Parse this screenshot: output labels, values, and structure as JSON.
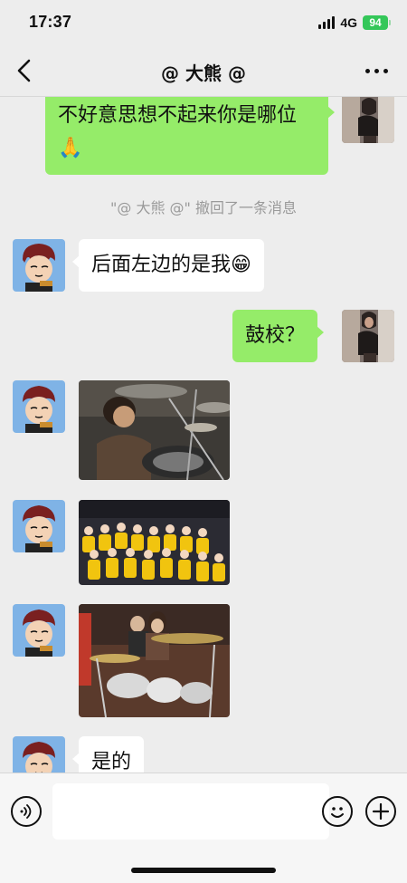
{
  "status": {
    "time": "17:37",
    "network": "4G",
    "battery": "94"
  },
  "nav": {
    "title": "@ 大熊 @",
    "back_icon": "chevron-left-icon",
    "more_icon": "more-dots-icon"
  },
  "messages": [
    {
      "side": "right",
      "type": "text",
      "text": "不好意思想不起来你是哪位🙏"
    },
    {
      "side": "center",
      "type": "system",
      "text": "\"@ 大熊 @\" 撤回了一条消息"
    },
    {
      "side": "left",
      "type": "text",
      "text": "后面左边的是我😁"
    },
    {
      "side": "right",
      "type": "text",
      "text": "鼓校？"
    },
    {
      "side": "left",
      "type": "image",
      "desc": "drummer-photo"
    },
    {
      "side": "left",
      "type": "image",
      "desc": "choir-photo"
    },
    {
      "side": "left",
      "type": "image",
      "desc": "drum-kit-group-photo"
    },
    {
      "side": "left",
      "type": "text",
      "text": "是的"
    }
  ],
  "input": {
    "placeholder": "",
    "voice_icon": "voice-icon",
    "emoji_icon": "emoji-icon",
    "plus_icon": "plus-icon"
  },
  "colors": {
    "bg": "#ededed",
    "green_bubble": "#95ec69",
    "white_bubble": "#ffffff",
    "battery": "#34c759"
  }
}
